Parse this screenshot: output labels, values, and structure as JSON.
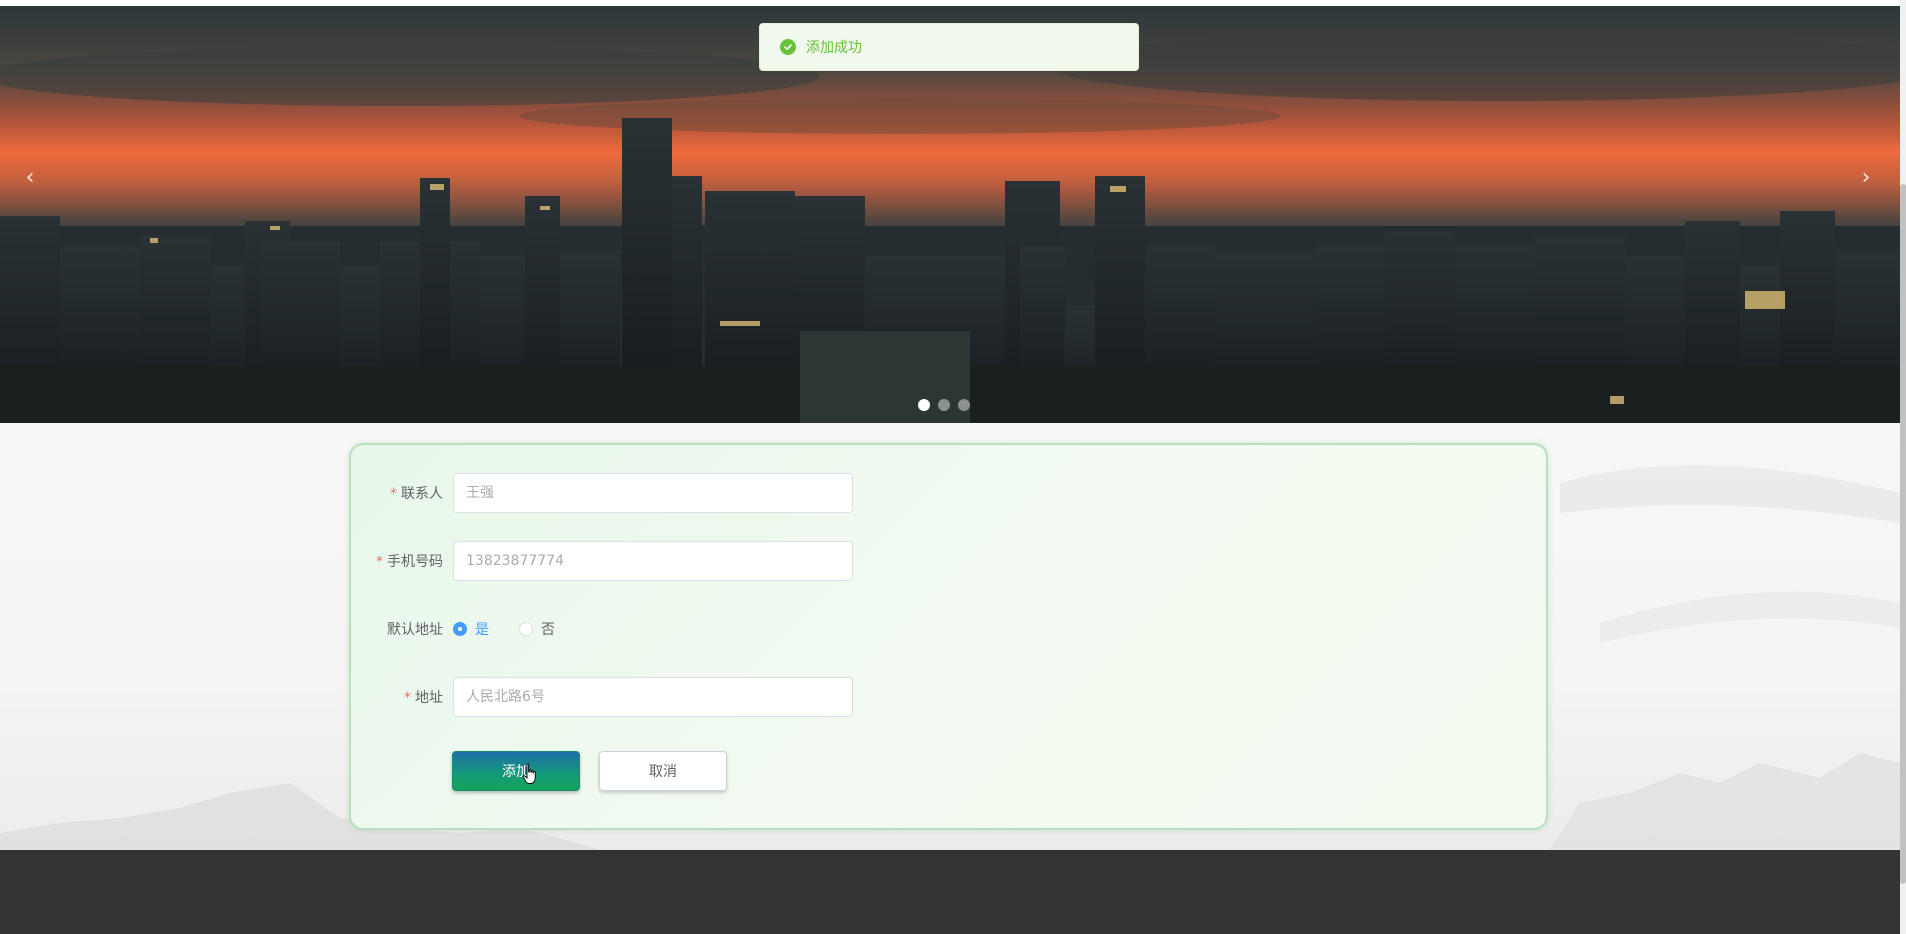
{
  "toast": {
    "message": "添加成功",
    "icon": "check-circle-icon"
  },
  "carousel": {
    "prev_icon": "chevron-left-icon",
    "next_icon": "chevron-right-icon",
    "prev_glyph": "‹",
    "next_glyph": "›",
    "slide_count": 3,
    "active_index": 0
  },
  "form": {
    "contact": {
      "label": "联系人",
      "placeholder": "王强",
      "required": true
    },
    "phone": {
      "label": "手机号码",
      "placeholder": "13823877774",
      "required": true
    },
    "default_address": {
      "label": "默认地址",
      "options": [
        "是",
        "否"
      ],
      "selected": "是"
    },
    "address": {
      "label": "地址",
      "placeholder": "人民北路6号",
      "required": true
    },
    "required_mark": "*",
    "submit_label": "添加",
    "cancel_label": "取消"
  },
  "colors": {
    "success": "#67c23a",
    "primary": "#409eff",
    "required": "#f56c6c",
    "footer": "#333333"
  }
}
